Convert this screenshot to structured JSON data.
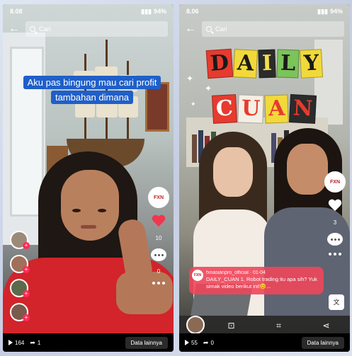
{
  "left": {
    "status": {
      "time": "8.08",
      "battery": "94%"
    },
    "search": {
      "placeholder": "Cari"
    },
    "caption": "Aku pas bingung mau cari profit tambahan dimana",
    "actions": {
      "likes": "10",
      "comments": "0"
    },
    "bottom": {
      "views": "164",
      "shares": "1",
      "data_button": "Data lainnya"
    }
  },
  "right": {
    "status": {
      "time": "8.06",
      "battery": "94%"
    },
    "search": {
      "placeholder": "Cari"
    },
    "title_line1": [
      "D",
      "A",
      "I",
      "L",
      "Y"
    ],
    "title_line2": [
      "C",
      "U",
      "A",
      "N"
    ],
    "actions": {
      "likes": "3"
    },
    "comment": {
      "user": "fxnasianpro_official · 01-04",
      "text": "DAILY_CUAN 1. Robot trading itu apa sih? Yuk simak video berikut ini!😊..."
    },
    "bottom": {
      "views": "55",
      "shares": "0",
      "data_button": "Data lainnya"
    }
  },
  "colors": {
    "like_red": "#f2364d",
    "caption_blue": "#1f5fc9",
    "comment_pink": "#f0465a",
    "shirt_red": "#d2242a"
  },
  "icons": [
    "back-arrow-icon",
    "search-icon",
    "heart-icon",
    "comment-icon",
    "more-icon",
    "play-icon",
    "share-icon"
  ]
}
